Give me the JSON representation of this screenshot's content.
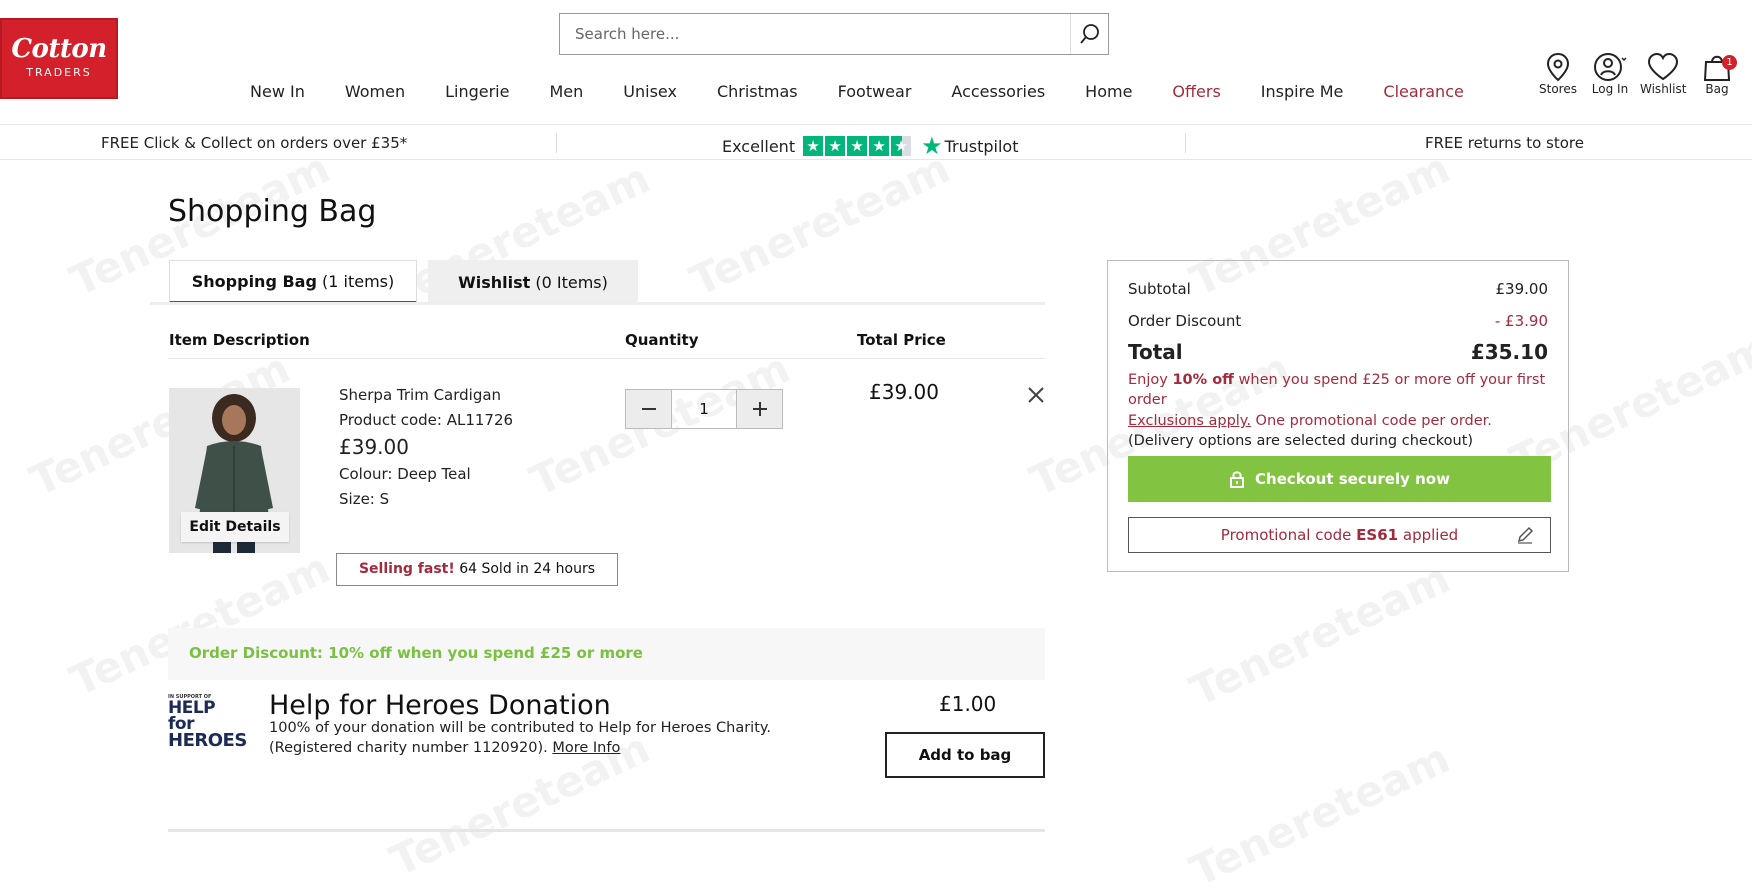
{
  "logo": {
    "line1": "Cotton",
    "line2": "TRADERS"
  },
  "search": {
    "placeholder": "Search here..."
  },
  "nav": [
    {
      "label": "New In"
    },
    {
      "label": "Women"
    },
    {
      "label": "Lingerie"
    },
    {
      "label": "Men"
    },
    {
      "label": "Unisex"
    },
    {
      "label": "Christmas"
    },
    {
      "label": "Footwear"
    },
    {
      "label": "Accessories"
    },
    {
      "label": "Home"
    },
    {
      "label": "Offers"
    },
    {
      "label": "Inspire Me"
    },
    {
      "label": "Clearance"
    }
  ],
  "header_icons": {
    "stores": "Stores",
    "login": "Log In",
    "wishlist": "Wishlist",
    "bag": "Bag",
    "bag_count": "1"
  },
  "strip": {
    "left": "FREE Click & Collect on orders over £35*",
    "rating_word": "Excellent",
    "trustpilot": "Trustpilot",
    "right": "FREE returns to store"
  },
  "watermark": "Tenereteam",
  "page_title": "Shopping Bag",
  "tabs": {
    "bag_label": "Shopping Bag",
    "bag_count": "(1 items)",
    "wishlist_label": "Wishlist",
    "wishlist_count": "(0 Items)"
  },
  "table_headers": {
    "item": "Item Description",
    "quantity": "Quantity",
    "total": "Total Price"
  },
  "item": {
    "name": "Sherpa Trim Cardigan",
    "code": "Product code: AL11726",
    "price": "£39.00",
    "colour": "Colour: Deep Teal",
    "size": "Size: S",
    "edit": "Edit Details",
    "quantity": "1",
    "total": "£39.00",
    "selling_fast": "Selling fast!",
    "sold_text": "64 Sold in 24 hours"
  },
  "order_discount_banner": "Order Discount: 10% off when you spend £25 or more",
  "donation": {
    "logo_small": "IN SUPPORT OF",
    "logo_line1": "HELP for",
    "logo_line2": "HEROES",
    "title": "Help for Heroes Donation",
    "line1": "100% of your donation will be contributed to Help for Heroes Charity.",
    "line2": "(Registered charity number 1120920).",
    "more_info": "More Info",
    "price": "£1.00",
    "button": "Add to bag"
  },
  "summary": {
    "subtotal_label": "Subtotal",
    "subtotal": "£39.00",
    "discount_label": "Order Discount",
    "discount": "- £3.90",
    "total_label": "Total",
    "total": "£35.10",
    "promo_pre": "Enjoy ",
    "promo_bold": "10% off",
    "promo_post": " when you spend £25 or more off your first order",
    "exclusions": "Exclusions apply.",
    "exclusions_post": " One promotional code per order.",
    "delivery_note": "(Delivery options are selected during checkout)",
    "checkout": "Checkout securely now",
    "promo_code_pre": "Promotional code ",
    "promo_code": "ES61",
    "promo_code_post": " applied"
  },
  "colors": {
    "brand_red": "#d3202a",
    "accent_red": "#a32b3e",
    "green": "#82c341",
    "trustpilot": "#00b67a"
  }
}
